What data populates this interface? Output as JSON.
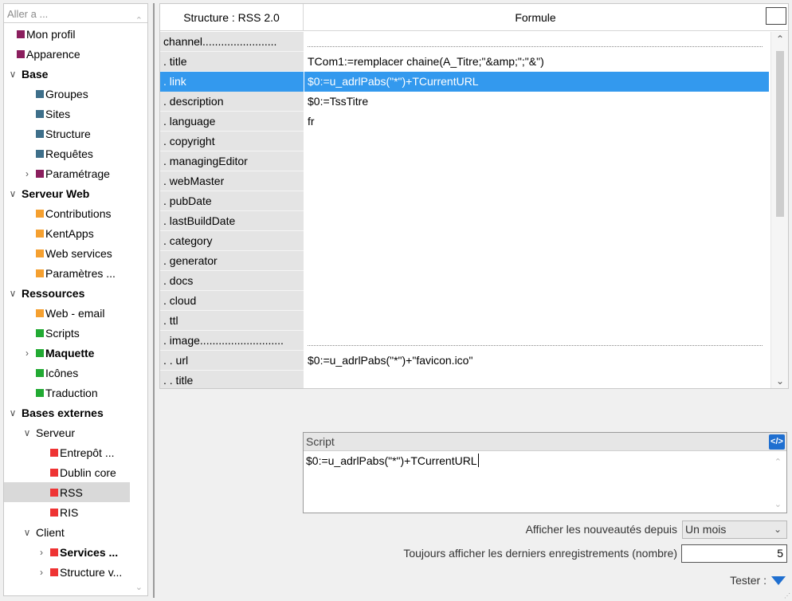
{
  "sidebar": {
    "search_placeholder": "Aller a ...",
    "items": [
      {
        "label": "Mon profil",
        "indent": 0,
        "expander": "",
        "color": "#8b1f5e",
        "bold": false,
        "selected": false
      },
      {
        "label": "Apparence",
        "indent": 0,
        "expander": "",
        "color": "#8b1f5e",
        "bold": false,
        "selected": false
      },
      {
        "label": "Base",
        "indent": 0,
        "expander": "expanded",
        "color": "",
        "bold": true,
        "selected": false
      },
      {
        "label": "Groupes",
        "indent": 1,
        "expander": "",
        "color": "#3e6f8a",
        "bold": false,
        "selected": false
      },
      {
        "label": "Sites",
        "indent": 1,
        "expander": "",
        "color": "#3e6f8a",
        "bold": false,
        "selected": false
      },
      {
        "label": "Structure",
        "indent": 1,
        "expander": "",
        "color": "#3e6f8a",
        "bold": false,
        "selected": false
      },
      {
        "label": "Requêtes",
        "indent": 1,
        "expander": "",
        "color": "#3e6f8a",
        "bold": false,
        "selected": false
      },
      {
        "label": "Paramétrage",
        "indent": 1,
        "expander": "collapsed",
        "color": "#8b1f5e",
        "bold": false,
        "selected": false
      },
      {
        "label": "Serveur Web",
        "indent": 0,
        "expander": "expanded",
        "color": "",
        "bold": true,
        "selected": false
      },
      {
        "label": "Contributions",
        "indent": 1,
        "expander": "",
        "color": "#f5a030",
        "bold": false,
        "selected": false
      },
      {
        "label": "KentApps",
        "indent": 1,
        "expander": "",
        "color": "#f5a030",
        "bold": false,
        "selected": false
      },
      {
        "label": "Web services",
        "indent": 1,
        "expander": "",
        "color": "#f5a030",
        "bold": false,
        "selected": false
      },
      {
        "label": "Paramètres ...",
        "indent": 1,
        "expander": "",
        "color": "#f5a030",
        "bold": false,
        "selected": false
      },
      {
        "label": "Ressources",
        "indent": 0,
        "expander": "expanded",
        "color": "",
        "bold": true,
        "selected": false
      },
      {
        "label": "Web - email",
        "indent": 1,
        "expander": "",
        "color": "#f5a030",
        "bold": false,
        "selected": false
      },
      {
        "label": "Scripts",
        "indent": 1,
        "expander": "",
        "color": "#22aa33",
        "bold": false,
        "selected": false
      },
      {
        "label": "Maquette",
        "indent": 1,
        "expander": "collapsed",
        "color": "#22aa33",
        "bold": true,
        "selected": false
      },
      {
        "label": "Icônes",
        "indent": 1,
        "expander": "",
        "color": "#22aa33",
        "bold": false,
        "selected": false
      },
      {
        "label": "Traduction",
        "indent": 1,
        "expander": "",
        "color": "#22aa33",
        "bold": false,
        "selected": false
      },
      {
        "label": "Bases externes",
        "indent": 0,
        "expander": "expanded",
        "color": "",
        "bold": true,
        "selected": false
      },
      {
        "label": "Serveur",
        "indent": 1,
        "expander": "expanded",
        "color": "",
        "bold": false,
        "selected": false
      },
      {
        "label": "Entrepôt ...",
        "indent": 2,
        "expander": "",
        "color": "#ee3333",
        "bold": false,
        "selected": false
      },
      {
        "label": "Dublin core",
        "indent": 2,
        "expander": "",
        "color": "#ee3333",
        "bold": false,
        "selected": false
      },
      {
        "label": "RSS",
        "indent": 2,
        "expander": "",
        "color": "#ee3333",
        "bold": false,
        "selected": true
      },
      {
        "label": "RIS",
        "indent": 2,
        "expander": "",
        "color": "#ee3333",
        "bold": false,
        "selected": false
      },
      {
        "label": "Client",
        "indent": 1,
        "expander": "expanded",
        "color": "",
        "bold": false,
        "selected": false
      },
      {
        "label": "Services ...",
        "indent": 2,
        "expander": "collapsed",
        "color": "#ee3333",
        "bold": true,
        "selected": false
      },
      {
        "label": "Structure v...",
        "indent": 2,
        "expander": "collapsed",
        "color": "#ee3333",
        "bold": false,
        "selected": false
      }
    ]
  },
  "grid": {
    "col1_header": "Structure : RSS 2.0",
    "col2_header": "Formule",
    "rows": [
      {
        "name": "channel........................",
        "formula": "",
        "dotted": true,
        "selected": false
      },
      {
        "name": ". title",
        "formula": "TCom1:=remplacer chaine(A_Titre;\"&amp;\";\"&\")",
        "dotted": false,
        "selected": false
      },
      {
        "name": ". link",
        "formula": "$0:=u_adrlPabs(\"*\")+TCurrentURL",
        "dotted": false,
        "selected": true
      },
      {
        "name": ". description",
        "formula": "$0:=TssTitre",
        "dotted": false,
        "selected": false
      },
      {
        "name": ". language",
        "formula": "fr",
        "dotted": false,
        "selected": false
      },
      {
        "name": ". copyright",
        "formula": "",
        "dotted": false,
        "selected": false
      },
      {
        "name": ". managingEditor",
        "formula": "",
        "dotted": false,
        "selected": false
      },
      {
        "name": ". webMaster",
        "formula": "",
        "dotted": false,
        "selected": false
      },
      {
        "name": ". pubDate",
        "formula": "",
        "dotted": false,
        "selected": false
      },
      {
        "name": ". lastBuildDate",
        "formula": "",
        "dotted": false,
        "selected": false
      },
      {
        "name": ". category",
        "formula": "",
        "dotted": false,
        "selected": false
      },
      {
        "name": ". generator",
        "formula": "",
        "dotted": false,
        "selected": false
      },
      {
        "name": ". docs",
        "formula": "",
        "dotted": false,
        "selected": false
      },
      {
        "name": ". cloud",
        "formula": "",
        "dotted": false,
        "selected": false
      },
      {
        "name": ". ttl",
        "formula": "",
        "dotted": false,
        "selected": false
      },
      {
        "name": ". image...........................",
        "formula": "",
        "dotted": true,
        "selected": false
      },
      {
        "name": ". . url",
        "formula": "$0:=u_adrlPabs(\"*\")+\"favicon.ico\"",
        "dotted": false,
        "selected": false
      },
      {
        "name": ". . title",
        "formula": "",
        "dotted": false,
        "selected": false
      }
    ]
  },
  "script": {
    "title": "Script",
    "icon": "code-icon",
    "content": "$0:=u_adrlPabs(\"*\")+TCurrentURL"
  },
  "options": {
    "news_label": "Afficher les nouveautés depuis",
    "news_value": "Un mois",
    "records_label": "Toujours afficher les derniers enregistrements (nombre)",
    "records_value": "5",
    "tester_label": "Tester :"
  },
  "colors": {
    "selection": "#3399ee",
    "accent": "#1f6fd0"
  }
}
